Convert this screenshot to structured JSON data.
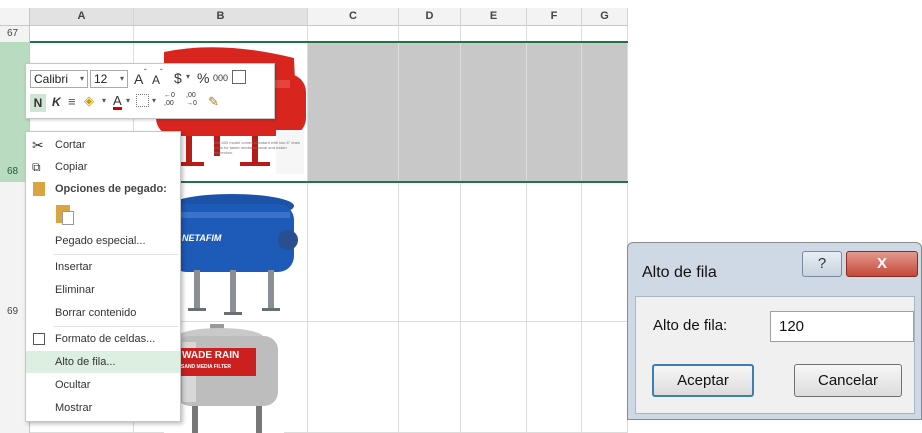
{
  "columns": [
    "A",
    "B",
    "C",
    "D",
    "E",
    "F",
    "G"
  ],
  "rows": [
    "67",
    "68",
    "69"
  ],
  "mini_toolbar": {
    "font_name": "Calibri",
    "font_size": "12",
    "grow_font": "A",
    "shrink_font": "A",
    "currency": "$",
    "percent": "%",
    "thousands": "000",
    "bold": "N",
    "italic": "K",
    "font_color": "A",
    "increase_decimal": "←0\n,00",
    "decrease_decimal": ",00\n→0"
  },
  "context_menu": {
    "cut": "Cortar",
    "copy": "Copiar",
    "paste_options": "Opciones de pegado:",
    "paste_special": "Pegado especial...",
    "insert": "Insertar",
    "delete": "Eliminar",
    "clear": "Borrar contenido",
    "format_cells": "Formato de celdas...",
    "row_height": "Alto de fila...",
    "hide": "Ocultar",
    "show": "Mostrar"
  },
  "images": {
    "netafim": "NETAFIM",
    "wade_rain": "WADE RAIN",
    "wade_rain_sub": "SAND MEDIA FILTER",
    "red_caption": "DM-400 model comes standard with two 6\" drain ports for faster media removal and easier inspection."
  },
  "dialog": {
    "title": "Alto de fila",
    "help": "?",
    "close": "X",
    "label": "Alto de fila:",
    "value": "120",
    "ok": "Aceptar",
    "cancel": "Cancelar"
  },
  "colors": {
    "selection_green": "#217346",
    "dialog_frame": "#cfd9e5",
    "close_red": "#c4483a"
  }
}
